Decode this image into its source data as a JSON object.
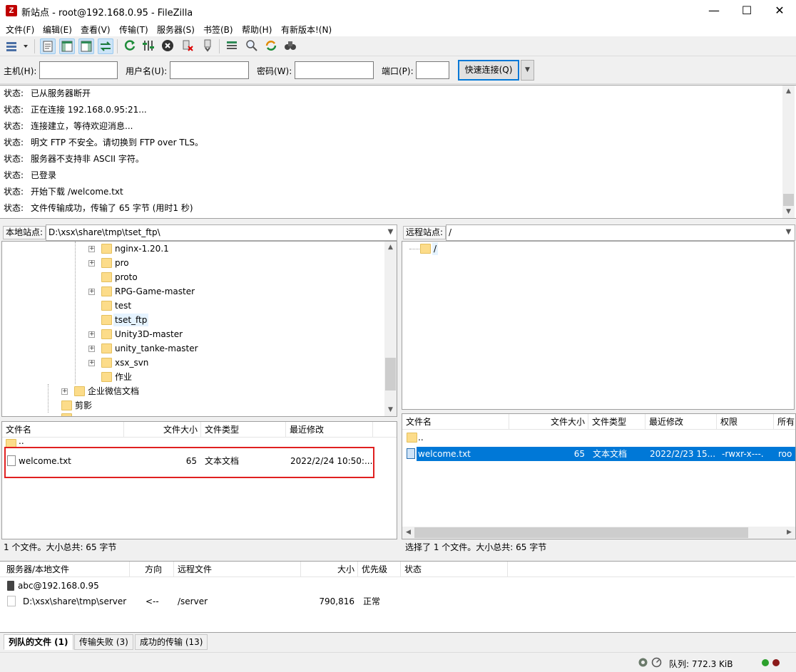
{
  "window": {
    "title": "新站点 - root@192.168.0.95 - FileZilla",
    "app_icon_text": "Z",
    "minimize": "—",
    "maximize": "☐",
    "close": "✕"
  },
  "menu": [
    "文件(F)",
    "编辑(E)",
    "查看(V)",
    "传输(T)",
    "服务器(S)",
    "书签(B)",
    "帮助(H)",
    "有新版本!(N)"
  ],
  "quickconnect": {
    "host_label": "主机(H):",
    "user_label": "用户名(U):",
    "pass_label": "密码(W):",
    "port_label": "端口(P):",
    "host_value": "",
    "user_value": "",
    "pass_value": "",
    "port_value": "",
    "connect_button": "快速连接(Q)",
    "dropdown_icon": "▼"
  },
  "log": [
    {
      "label": "状态:",
      "text": "已从服务器断开"
    },
    {
      "label": "状态:",
      "text": "正在连接 192.168.0.95:21..."
    },
    {
      "label": "状态:",
      "text": "连接建立，等待欢迎消息..."
    },
    {
      "label": "状态:",
      "text": "明文 FTP 不安全。请切换到 FTP over TLS。"
    },
    {
      "label": "状态:",
      "text": "服务器不支持非 ASCII 字符。"
    },
    {
      "label": "状态:",
      "text": "已登录"
    },
    {
      "label": "状态:",
      "text": "开始下载 /welcome.txt"
    },
    {
      "label": "状态:",
      "text": "文件传输成功，传输了 65 字节 (用时1 秒)"
    }
  ],
  "local": {
    "site_label": "本地站点:",
    "path": "D:\\xsx\\share\\tmp\\tset_ftp\\",
    "tree": [
      {
        "name": "nginx-1.20.1",
        "expander": "+"
      },
      {
        "name": "pro",
        "expander": "+"
      },
      {
        "name": "proto",
        "expander": ""
      },
      {
        "name": "RPG-Game-master",
        "expander": "+"
      },
      {
        "name": "test",
        "expander": ""
      },
      {
        "name": "tset_ftp",
        "expander": "",
        "selected": true
      },
      {
        "name": "Unity3D-master",
        "expander": "+"
      },
      {
        "name": "unity_tanke-master",
        "expander": "+"
      },
      {
        "name": "xsx_svn",
        "expander": "+"
      },
      {
        "name": "作业",
        "expander": ""
      },
      {
        "name": "企业微信文档",
        "expander": "+"
      },
      {
        "name": "剪影",
        "expander": ""
      }
    ],
    "columns": [
      "文件名",
      "文件大小",
      "文件类型",
      "最近修改"
    ],
    "parent": "..",
    "files": [
      {
        "name": "welcome.txt",
        "size": "65",
        "type": "文本文档",
        "modified": "2022/2/24 10:50:..."
      }
    ],
    "status": "1 个文件。大小总共: 65 字节"
  },
  "remote": {
    "site_label": "远程站点:",
    "path": "/",
    "tree_root": "/",
    "columns": [
      "文件名",
      "文件大小",
      "文件类型",
      "最近修改",
      "权限",
      "所有"
    ],
    "parent": "..",
    "files": [
      {
        "name": "welcome.txt",
        "size": "65",
        "type": "文本文档",
        "modified": "2022/2/23 15...",
        "perms": "-rwxr-x---.",
        "owner": "roo"
      }
    ],
    "status": "选择了 1 个文件。大小总共: 65 字节"
  },
  "queue": {
    "columns": [
      "服务器/本地文件",
      "方向",
      "远程文件",
      "大小",
      "优先级",
      "状态"
    ],
    "server": "abc@192.168.0.95",
    "item": {
      "local": "D:\\xsx\\share\\tmp\\server",
      "direction": "<--",
      "remote": "/server",
      "size": "790,816",
      "priority": "正常"
    },
    "tabs": [
      "列队的文件 (1)",
      "传输失败 (3)",
      "成功的传输 (13)"
    ]
  },
  "statusbar": {
    "queue": "队列: 772.3 KiB"
  },
  "colors": {
    "accent": "#0078d7",
    "selection": "#0078d7",
    "highlight_box": "#e02020"
  }
}
